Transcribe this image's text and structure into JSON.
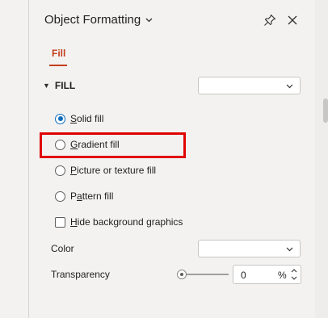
{
  "panel": {
    "title": "Object Formatting",
    "tabs": [
      {
        "label": "Fill",
        "active": true
      }
    ]
  },
  "fill_section": {
    "header": "FILL",
    "options": [
      {
        "label": "Solid fill",
        "underline_char": "S",
        "type": "radio",
        "checked": true
      },
      {
        "label": "Gradient fill",
        "underline_char": "G",
        "type": "radio",
        "checked": false
      },
      {
        "label": "Picture or texture fill",
        "underline_char": "P",
        "type": "radio",
        "checked": false
      },
      {
        "label": "Pattern fill",
        "underline_char": "a",
        "type": "radio",
        "checked": false
      },
      {
        "label": "Hide background graphics",
        "underline_char": "H",
        "type": "checkbox",
        "checked": false
      }
    ],
    "color_label": "Color",
    "transparency_label": "Transparency",
    "transparency": {
      "value": "0",
      "unit": "%",
      "slider_fraction": 0
    }
  },
  "colors": {
    "accent": "#c43e1c",
    "radio_selected": "#0f6cbd",
    "highlight_box": "#e00000"
  },
  "icons": [
    "chevron-down-icon",
    "pin-icon",
    "close-icon",
    "collapse-caret-icon",
    "spin-arrows-icon"
  ]
}
